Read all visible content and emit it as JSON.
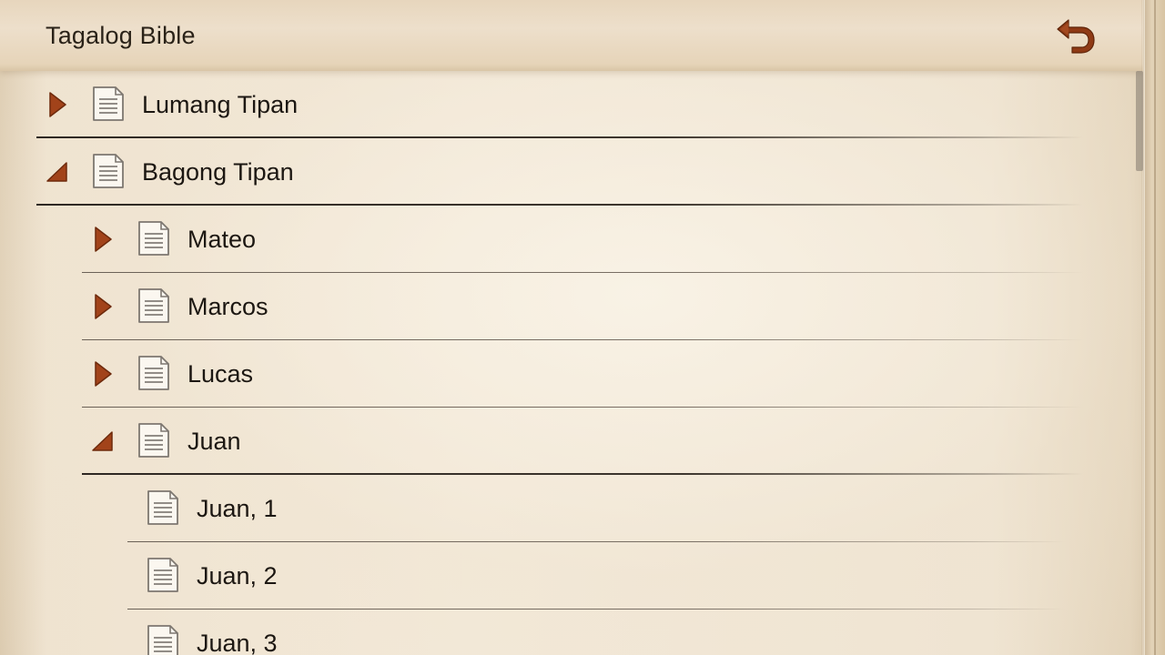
{
  "header": {
    "title": "Tagalog Bible",
    "back_icon": "undo-arrow-icon"
  },
  "colors": {
    "accent": "#9a3d16",
    "accent_dark": "#6e2a0c",
    "text": "#1c1712"
  },
  "tree": {
    "items": [
      {
        "label": "Lumang Tipan",
        "level": 0,
        "state": "collapsed"
      },
      {
        "label": "Bagong Tipan",
        "level": 0,
        "state": "expanded"
      },
      {
        "label": "Mateo",
        "level": 1,
        "state": "collapsed"
      },
      {
        "label": "Marcos",
        "level": 1,
        "state": "collapsed"
      },
      {
        "label": "Lucas",
        "level": 1,
        "state": "collapsed"
      },
      {
        "label": "Juan",
        "level": 1,
        "state": "expanded"
      },
      {
        "label": "Juan, 1",
        "level": 2,
        "state": "leaf"
      },
      {
        "label": "Juan, 2",
        "level": 2,
        "state": "leaf"
      },
      {
        "label": "Juan, 3",
        "level": 2,
        "state": "leaf"
      }
    ]
  }
}
